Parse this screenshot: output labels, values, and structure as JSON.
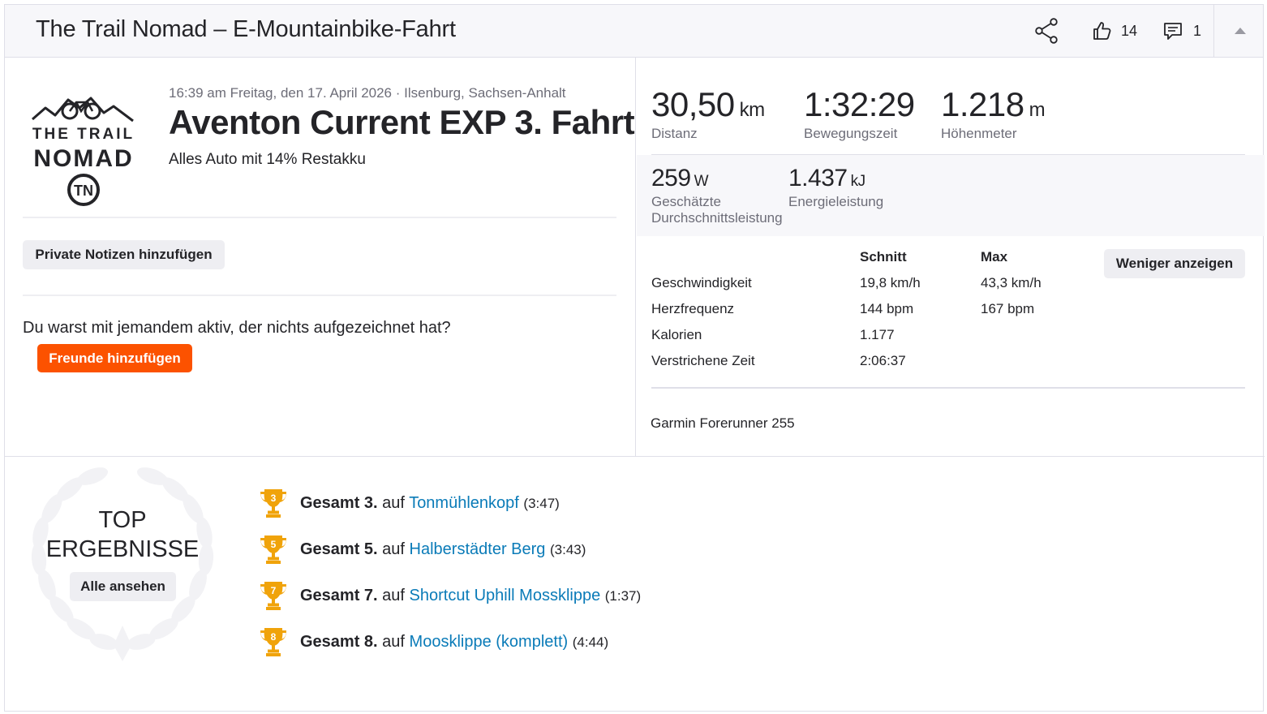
{
  "header": {
    "title": "The Trail Nomad – E-Mountainbike-Fahrt",
    "kudos_count": "14",
    "comment_count": "1"
  },
  "athlete": {
    "logo_text_top": "THE TRAIL",
    "logo_text_bottom": "NOMAD",
    "logo_monogram": "TN"
  },
  "activity": {
    "meta": "16:39 am Freitag, den 17. April 2026 · Ilsenburg, Sachsen-Anhalt",
    "title": "Aventon Current EXP 3. Fahrt",
    "description": "Alles Auto mit 14% Restakku",
    "notes_button": "Private Notizen hinzufügen",
    "friends_question": "Du warst mit jemandem aktiv, der nichts aufgezeichnet hat?",
    "friends_button": "Freunde hinzufügen"
  },
  "stats": {
    "distance": {
      "value": "30,50",
      "unit": "km",
      "label": "Distanz"
    },
    "moving_time": {
      "value": "1:32:29",
      "label": "Bewegungszeit"
    },
    "elevation": {
      "value": "1.218",
      "unit": "m",
      "label": "Höhenmeter"
    },
    "power": {
      "value": "259",
      "unit": "W",
      "label_line1": "Geschätzte",
      "label_line2": "Durchschnittsleistung"
    },
    "energy": {
      "value": "1.437",
      "unit": "kJ",
      "label": "Energieleistung"
    }
  },
  "details": {
    "col_avg": "Schnitt",
    "col_max": "Max",
    "less_button": "Weniger anzeigen",
    "rows": [
      {
        "label": "Geschwindigkeit",
        "avg": "19,8 km/h",
        "max": "43,3 km/h"
      },
      {
        "label": "Herzfrequenz",
        "avg": "144 bpm",
        "max": "167 bpm"
      },
      {
        "label": "Kalorien",
        "avg": "1.177",
        "max": ""
      },
      {
        "label": "Verstrichene Zeit",
        "avg": "2:06:37",
        "max": ""
      }
    ],
    "device": "Garmin Forerunner 255"
  },
  "top_results": {
    "title_line1": "TOP",
    "title_line2": "ERGEBNISSE",
    "all_button": "Alle ansehen",
    "items": [
      {
        "rank_num": "3",
        "rank": "Gesamt 3.",
        "on": "auf",
        "segment": "Tonmühlenkopf",
        "time": "(3:47)"
      },
      {
        "rank_num": "5",
        "rank": "Gesamt 5.",
        "on": "auf",
        "segment": "Halberstädter Berg",
        "time": "(3:43)"
      },
      {
        "rank_num": "7",
        "rank": "Gesamt 7.",
        "on": "auf",
        "segment": "Shortcut Uphill Mossklippe",
        "time": "(1:37)"
      },
      {
        "rank_num": "8",
        "rank": "Gesamt 8.",
        "on": "auf",
        "segment": "Moosklippe (komplett)",
        "time": "(4:44)"
      }
    ]
  },
  "colors": {
    "accent": "#fc5200",
    "link": "#0a7bb8",
    "trophy": "#f0a30a"
  }
}
